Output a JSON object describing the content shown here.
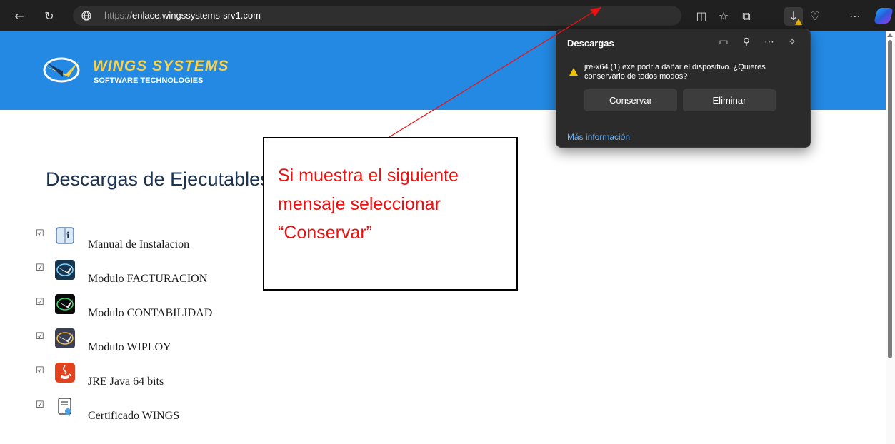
{
  "browser": {
    "url_scheme": "https://",
    "url_host": "enlace.wingssystems-srv1.com",
    "toolbar_icons": [
      "back-icon",
      "refresh-icon",
      "split-screen-icon",
      "favorites-icon",
      "collections-icon",
      "downloads-icon",
      "browser-essentials-icon",
      "more-icon",
      "copilot-icon"
    ]
  },
  "site": {
    "logo_title": "WINGS SYSTEMS",
    "logo_subtitle": "SOFTWARE TECHNOLOGIES",
    "brand_color": "#2389e3",
    "page_title": "Descargas de Ejecutables",
    "items": [
      {
        "label": "Manual de Instalacion",
        "icon": "info-book-icon"
      },
      {
        "label": "Modulo FACTURACION",
        "icon": "wings-facturacion-icon"
      },
      {
        "label": "Modulo CONTABILIDAD",
        "icon": "wings-contabilidad-icon"
      },
      {
        "label": "Modulo WIPLOY",
        "icon": "wings-wiploy-icon"
      },
      {
        "label": "JRE Java 64 bits",
        "icon": "java-icon"
      },
      {
        "label": "Certificado WINGS",
        "icon": "certificate-icon"
      }
    ]
  },
  "downloads_panel": {
    "title": "Descargas",
    "warning_text": "jre-x64 (1).exe podría dañar el dispositivo. ¿Quieres conservarlo de todos modos?",
    "keep_label": "Conservar",
    "delete_label": "Eliminar",
    "more_info": "Más información"
  },
  "annotation": {
    "line1": "Si muestra el siguiente",
    "line2": "mensaje seleccionar",
    "line3": "“Conservar”",
    "color": "#ee1111"
  }
}
